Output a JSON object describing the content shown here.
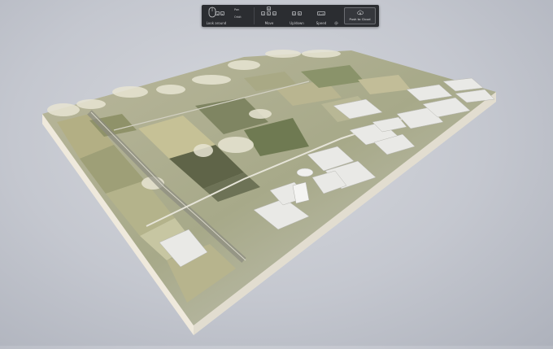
{
  "toolbar": {
    "look_around_label": "Look around",
    "pan_label": "Pan",
    "orbit_label": "Orbit",
    "move_label": "Move",
    "up_down_label": "Up/down",
    "speed_label": "Speed",
    "speed_keys": "1~4",
    "push_to_cloud_label": "Push to Cloud",
    "move_keys": [
      "W",
      "A",
      "S",
      "D"
    ],
    "updown_keys": [
      "Q",
      "E"
    ]
  }
}
